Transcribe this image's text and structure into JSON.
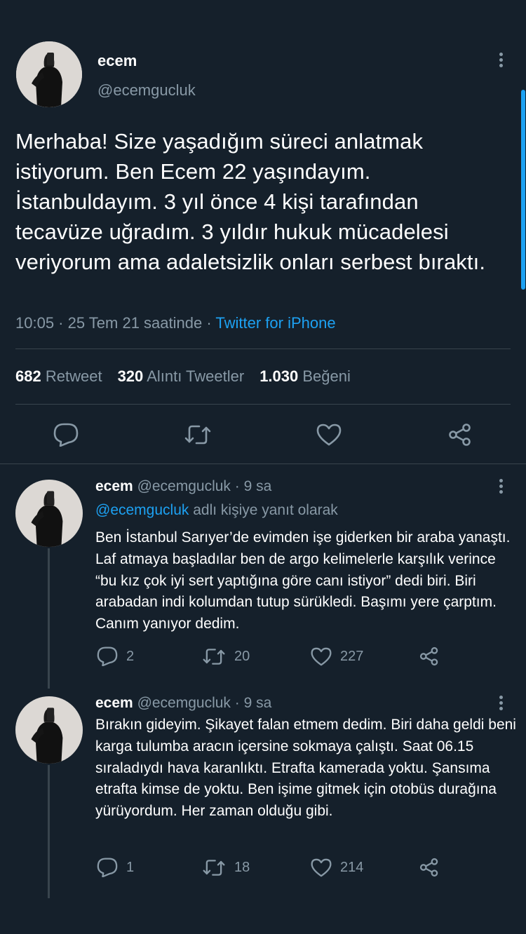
{
  "main_tweet": {
    "name": "ecem",
    "handle": "@ecemgucluk",
    "text": "Merhaba! Size yaşadığım süreci anlatmak istiyorum. Ben Ecem 22 yaşındayım. İstanbuldayım. 3 yıl önce 4 kişi tarafından tecavüze uğradım. 3 yıldır hukuk mücadelesi veriyorum ama adaletsizlik onları serbest bıraktı.",
    "time": "10:05 · 25 Tem 21 saatinde · ",
    "source": "Twitter for iPhone",
    "stats": {
      "retweets": "682",
      "retweets_label": "Retweet",
      "quotes": "320",
      "quotes_label": "Alıntı Tweetler",
      "likes": "1.030",
      "likes_label": "Beğeni"
    },
    "actions": [
      "reply-icon",
      "retweet-icon",
      "like-icon",
      "share-icon"
    ]
  },
  "replies": [
    {
      "name": "ecem",
      "handle": "@ecemgucluk",
      "time": " · 9 sa",
      "reply_to_handle": "@ecemgucluk",
      "reply_to_suffix": " adlı kişiye yanıt olarak",
      "text": "Ben İstanbul Sarıyer’de evimden işe giderken bir araba yanaştı. Laf atmaya başladılar ben de argo kelimelerle karşılık verince “bu kız çok iyi sert yaptığına göre canı istiyor” dedi biri. Biri arabadan indi kolumdan tutup sürükledi. Başımı yere çarptım. Canım yanıyor dedim.",
      "replies": "2",
      "retweets": "20",
      "likes": "227"
    },
    {
      "name": "ecem",
      "handle": "@ecemgucluk",
      "time": " · 9 sa",
      "text": "Bırakın gideyim. Şikayet falan etmem dedim. Biri daha geldi beni karga tulumba aracın içersine sokmaya çalıştı. Saat 06.15 sıraladıydı hava karanlıktı. Etrafta kamerada yoktu. Şansıma etrafta kimse de yoktu. Ben işime gitmek için otobüs durağına yürüyordum. Her zaman olduğu gibi.",
      "replies": "1",
      "retweets": "18",
      "likes": "214"
    }
  ],
  "colors": {
    "background": "#15202b",
    "text": "#ffffff",
    "muted": "#8899a6",
    "link": "#1da1f2",
    "divider": "#38444d"
  }
}
